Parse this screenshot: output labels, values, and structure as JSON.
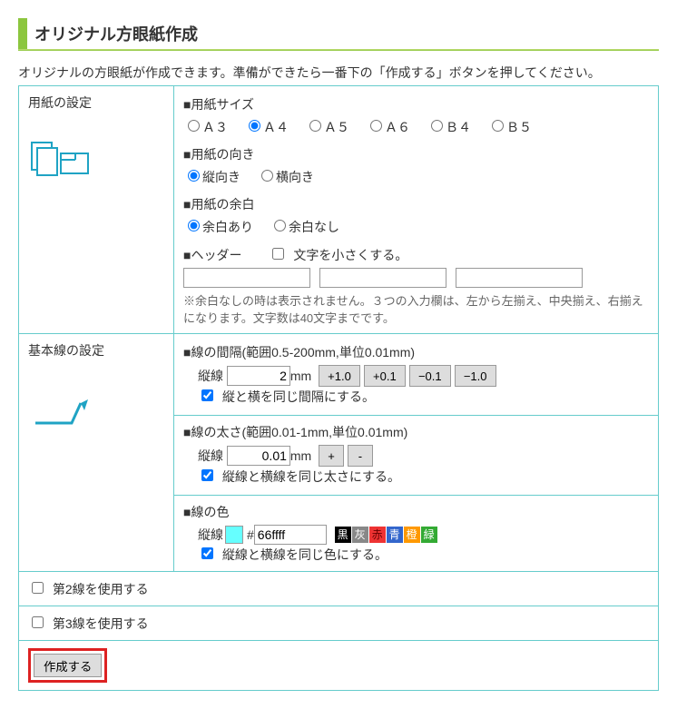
{
  "title": "オリジナル方眼紙作成",
  "intro": "オリジナルの方眼紙が作成できます。準備ができたら一番下の「作成する」ボタンを押してください。",
  "paper": {
    "section_label": "用紙の設定",
    "size": {
      "label": "■用紙サイズ",
      "opts": [
        "Ａ３",
        "Ａ４",
        "Ａ５",
        "Ａ６",
        "Ｂ４",
        "Ｂ５"
      ],
      "selected": "Ａ４"
    },
    "orient": {
      "label": "■用紙の向き",
      "opts": [
        "縦向き",
        "横向き"
      ],
      "selected": "縦向き"
    },
    "margin": {
      "label": "■用紙の余白",
      "opts": [
        "余白あり",
        "余白なし"
      ],
      "selected": "余白あり"
    },
    "header": {
      "label": "■ヘッダー",
      "small_label": "文字を小さくする。",
      "note": "※余白なしの時は表示されません。３つの入力欄は、左から左揃え、中央揃え、右揃えになります。文字数は40文字までです。"
    }
  },
  "baseline": {
    "section_label": "基本線の設定",
    "spacing": {
      "label": "■線の間隔(範囲0.5-200mm,単位0.01mm)",
      "field": "縦線",
      "value": "2",
      "unit": "mm",
      "b1": "+1.0",
      "b2": "+0.1",
      "b3": "−0.1",
      "b4": "−1.0",
      "same": "縦と横を同じ間隔にする。"
    },
    "thickness": {
      "label": "■線の太さ(範囲0.01-1mm,単位0.01mm)",
      "field": "縦線",
      "value": "0.01",
      "unit": "mm",
      "plus": "+",
      "minus": "-",
      "same": "縦線と横線を同じ太さにする。"
    },
    "color": {
      "label": "■線の色",
      "field": "縦線",
      "value": "66ffff",
      "same": "縦線と横線を同じ色にする。",
      "btns": {
        "black": "黒",
        "gray": "灰",
        "red": "赤",
        "blue": "青",
        "orange": "橙",
        "green": "緑"
      }
    }
  },
  "line2": "第2線を使用する",
  "line3": "第3線を使用する",
  "create": "作成する"
}
